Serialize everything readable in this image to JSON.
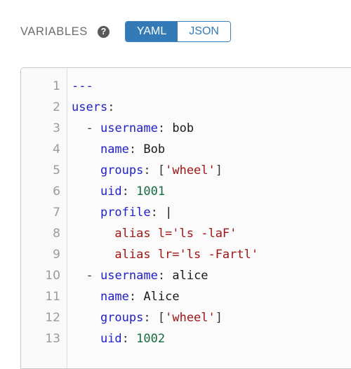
{
  "header": {
    "label": "VARIABLES",
    "help_icon": "question-mark-circle-icon",
    "help_glyph": "?",
    "toggle": {
      "options": [
        {
          "label": "YAML",
          "active": true
        },
        {
          "label": "JSON",
          "active": false
        }
      ],
      "selected": "YAML",
      "active_bg": "#337ab7",
      "active_text": "#ffffff",
      "inactive_text": "#337ab7",
      "border_color": "#3a80c4"
    }
  },
  "editor": {
    "language": "yaml",
    "gutter_numbers": [
      "1",
      "2",
      "3",
      "4",
      "5",
      "6",
      "7",
      "8",
      "9",
      "10",
      "11",
      "12",
      "13"
    ],
    "lines": [
      {
        "n": "1",
        "text": "---"
      },
      {
        "n": "2",
        "text": "users:"
      },
      {
        "n": "3",
        "text": "  - username: bob"
      },
      {
        "n": "4",
        "text": "    name: Bob"
      },
      {
        "n": "5",
        "text": "    groups: ['wheel']"
      },
      {
        "n": "6",
        "text": "    uid: 1001"
      },
      {
        "n": "7",
        "text": "    profile: |"
      },
      {
        "n": "8",
        "text": "      alias l='ls -laF'"
      },
      {
        "n": "9",
        "text": "      alias lr='ls -Fartl'"
      },
      {
        "n": "10",
        "text": "  - username: alice"
      },
      {
        "n": "11",
        "text": "    name: Alice"
      },
      {
        "n": "12",
        "text": "    groups: ['wheel']"
      },
      {
        "n": "13",
        "text": "    uid: 1002"
      }
    ],
    "tokens": [
      [
        {
          "t": "---",
          "c": "tok-doc"
        }
      ],
      [
        {
          "t": "users",
          "c": "tok-key"
        },
        {
          "t": ":",
          "c": "tok-punct"
        }
      ],
      [
        {
          "t": "  ",
          "c": "tok-plain"
        },
        {
          "t": "-",
          "c": "tok-dash"
        },
        {
          "t": " ",
          "c": "tok-plain"
        },
        {
          "t": "username",
          "c": "tok-key"
        },
        {
          "t": ": ",
          "c": "tok-punct"
        },
        {
          "t": "bob",
          "c": "tok-plain"
        }
      ],
      [
        {
          "t": "    ",
          "c": "tok-plain"
        },
        {
          "t": "name",
          "c": "tok-key"
        },
        {
          "t": ": ",
          "c": "tok-punct"
        },
        {
          "t": "Bob",
          "c": "tok-plain"
        }
      ],
      [
        {
          "t": "    ",
          "c": "tok-plain"
        },
        {
          "t": "groups",
          "c": "tok-key"
        },
        {
          "t": ": ",
          "c": "tok-punct"
        },
        {
          "t": "[",
          "c": "tok-punct"
        },
        {
          "t": "'wheel'",
          "c": "tok-string"
        },
        {
          "t": "]",
          "c": "tok-punct"
        }
      ],
      [
        {
          "t": "    ",
          "c": "tok-plain"
        },
        {
          "t": "uid",
          "c": "tok-key"
        },
        {
          "t": ": ",
          "c": "tok-punct"
        },
        {
          "t": "1001",
          "c": "tok-number"
        }
      ],
      [
        {
          "t": "    ",
          "c": "tok-plain"
        },
        {
          "t": "profile",
          "c": "tok-key"
        },
        {
          "t": ": ",
          "c": "tok-punct"
        },
        {
          "t": "|",
          "c": "tok-plain"
        }
      ],
      [
        {
          "t": "      alias l='ls -laF'",
          "c": "tok-block"
        }
      ],
      [
        {
          "t": "      alias lr='ls -Fartl'",
          "c": "tok-block"
        }
      ],
      [
        {
          "t": "  ",
          "c": "tok-plain"
        },
        {
          "t": "-",
          "c": "tok-dash"
        },
        {
          "t": " ",
          "c": "tok-plain"
        },
        {
          "t": "username",
          "c": "tok-key"
        },
        {
          "t": ": ",
          "c": "tok-punct"
        },
        {
          "t": "alice",
          "c": "tok-plain"
        }
      ],
      [
        {
          "t": "    ",
          "c": "tok-plain"
        },
        {
          "t": "name",
          "c": "tok-key"
        },
        {
          "t": ": ",
          "c": "tok-punct"
        },
        {
          "t": "Alice",
          "c": "tok-plain"
        }
      ],
      [
        {
          "t": "    ",
          "c": "tok-plain"
        },
        {
          "t": "groups",
          "c": "tok-key"
        },
        {
          "t": ": ",
          "c": "tok-punct"
        },
        {
          "t": "[",
          "c": "tok-punct"
        },
        {
          "t": "'wheel'",
          "c": "tok-string"
        },
        {
          "t": "]",
          "c": "tok-punct"
        }
      ],
      [
        {
          "t": "    ",
          "c": "tok-plain"
        },
        {
          "t": "uid",
          "c": "tok-key"
        },
        {
          "t": ": ",
          "c": "tok-punct"
        },
        {
          "t": "1002",
          "c": "tok-number"
        }
      ]
    ]
  }
}
